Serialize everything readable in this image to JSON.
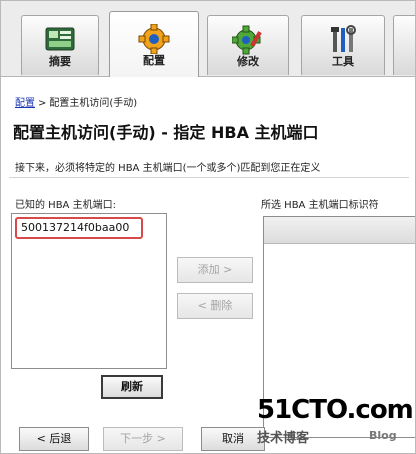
{
  "tabs": [
    {
      "label": "摘要",
      "icon": "summary-icon",
      "active": false
    },
    {
      "label": "配置",
      "icon": "gear-icon",
      "active": true
    },
    {
      "label": "修改",
      "icon": "modify-gear-icon",
      "active": false
    },
    {
      "label": "工具",
      "icon": "tools-icon",
      "active": false
    }
  ],
  "breadcrumb": {
    "link": "配置",
    "separator": ">",
    "current": "配置主机访问(手动)"
  },
  "page_title": "配置主机访问(手动) - 指定 HBA 主机端口",
  "instruction": "接下来，必须将特定的 HBA 主机端口(一个或多个)匹配到您正在定义",
  "known_ports": {
    "label": "已知的 HBA 主机端口:",
    "items": [
      "500137214f0baa00"
    ]
  },
  "selected_ports": {
    "label": "所选 HBA 主机端口标识符"
  },
  "buttons": {
    "add": "添加 >",
    "remove": "< 删除",
    "refresh": "刷新",
    "back": "< 后退",
    "next": "下一步 >",
    "cancel": "取消"
  },
  "watermark": {
    "logo": "51CTO.com",
    "sub": "技术博客",
    "blog": "Blog"
  },
  "colors": {
    "link": "#1a36b8",
    "highlight_border": "#d84a4a"
  }
}
